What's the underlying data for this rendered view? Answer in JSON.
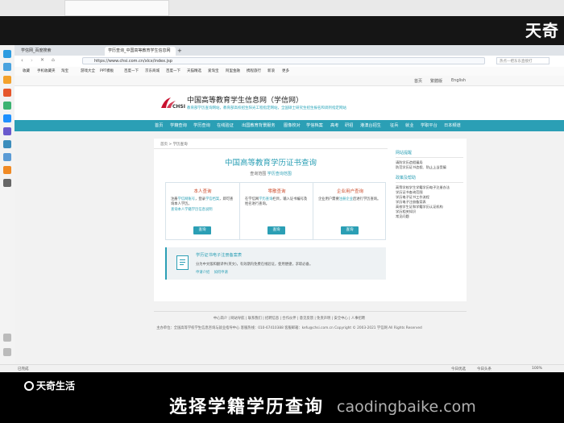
{
  "watermark_top": "天奇",
  "watermark_bottom": "天奇生活",
  "caption": "选择学籍学历查询",
  "watermark_url": "caodingbaike.com",
  "browser": {
    "tabs": [
      {
        "label": "学信网_百度搜索"
      },
      {
        "label": "学历查询_中国高等教育学生信息网"
      }
    ],
    "address": "https://www.chsi.com.cn/xlcx/index.jsp",
    "search_placeholder": "热点—把东东直接打",
    "bookmarks": [
      "收藏",
      "手机收藏夹",
      "淘宝",
      "游戏大全",
      "PPT模板",
      "百度一下",
      "京东商城",
      "百度一下",
      "天猫精选",
      "爱淘宝",
      "阿里金融",
      "携程旅行",
      "新浪",
      "更多"
    ],
    "status": "已完成",
    "status_right": [
      "今日优选",
      "今日头条",
      "100%"
    ]
  },
  "site": {
    "topline": [
      "首页",
      "繁體版",
      "English"
    ],
    "title": "中国高等教育学生信息网（学信网）",
    "logo_text": "CHSI",
    "slogan": "教育部学历查询网站，教育部高校招生阳光工程指定网站，全国硕士研究生招生报名和调剂指定网站",
    "nav": [
      "首页",
      "学籍查询",
      "学历查询",
      "在线验证",
      "出国教育背景服务",
      "图像校对",
      "学信档案",
      "高考",
      "研招",
      "港澳台招生",
      "征兵",
      "就业",
      "学职平台",
      "日本频道"
    ]
  },
  "content": {
    "breadcrumb": "首页 > 学历查询",
    "query_title": "中国高等教育学历证书查询",
    "query_sub_prefix": "查询范围",
    "query_sub_link": "学历查询范围",
    "cards": [
      {
        "title": "本人查询",
        "desc_1": "注册",
        "desc_link_1": "学信网账号",
        "desc_2": "，登录",
        "desc_link_2": "学信档案",
        "desc_3": "，即可查询本人学历。",
        "desc_link_3": "查询本人学籍学历信息说明",
        "button": "查询"
      },
      {
        "title": "零散查询",
        "desc_1": "在学信网",
        "desc_link_1": "学历查询",
        "desc_2": "栏目，输入证书编号及姓名进行查询。",
        "desc_link_2": "",
        "desc_3": "",
        "desc_link_3": "",
        "button": "查询"
      },
      {
        "title": "企业用户查询",
        "desc_1": "企业用户需要",
        "desc_link_1": "注册企业",
        "desc_2": "后进行学历查询。",
        "desc_link_2": "",
        "desc_3": "",
        "desc_link_3": "",
        "button": "查询"
      }
    ],
    "app": {
      "title": "学历证书电子注册备案表",
      "desc": "分为中文版和翻译件(英文)，有效期内免费在线验证，使用便捷，求职必备。",
      "link_1": "申请介绍",
      "link_2": "如何申请"
    }
  },
  "sidebar": {
    "notice_title": "网站提醒",
    "notice_items": [
      "请防学历造假骗局",
      "防范学历证书造假、防止上当受骗"
    ],
    "help_title": "政策及帮助",
    "help_items": [
      "高等学校学生学籍学历电子注册办法",
      "学历证书查询范围",
      "学历电子证书工作流程",
      "学历电子注册备案表",
      "高校学生证和学籍学历认证机构",
      "学历相关知识",
      "常见问题"
    ]
  },
  "footer": {
    "links": [
      "中心简介",
      "网站导航",
      "联系我们",
      "招聘信息",
      "合作伙伴",
      "意见反馈",
      "免责声明",
      "安全中心",
      "人事招聘"
    ],
    "line2_left": "主办单位：全国高等学校学生信息咨询与就业指导中心",
    "line2_mid": "客服热线：010-67410388",
    "line2_mail": "客服邮箱：kefu@chsi.com.cn",
    "line2_right": "Copyright © 2003-2021 学信网 All Rights Reserved"
  }
}
